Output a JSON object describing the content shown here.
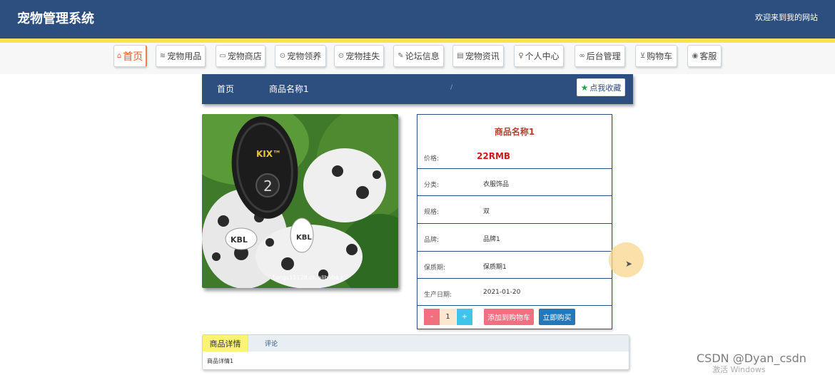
{
  "app": {
    "title": "宠物管理系统",
    "welcome": "欢迎来到我的网站"
  },
  "nav": [
    {
      "icon": "home-icon",
      "glyph": "⌂",
      "label": "首页"
    },
    {
      "icon": "supplies-icon",
      "glyph": "≋",
      "label": "宠物用品"
    },
    {
      "icon": "shop-icon",
      "glyph": "▭",
      "label": "宠物商店"
    },
    {
      "icon": "adopt-icon",
      "glyph": "⊙",
      "label": "宠物领养"
    },
    {
      "icon": "lost-icon",
      "glyph": "⊙",
      "label": "宠物挂失"
    },
    {
      "icon": "forum-icon",
      "glyph": "✎",
      "label": "论坛信息"
    },
    {
      "icon": "news-icon",
      "glyph": "▤",
      "label": "宠物资讯"
    },
    {
      "icon": "user-icon",
      "glyph": "♀",
      "label": "个人中心"
    },
    {
      "icon": "link-icon",
      "glyph": "∞",
      "label": "后台管理"
    },
    {
      "icon": "cart-icon",
      "glyph": "⊻",
      "label": "购物车"
    },
    {
      "icon": "service-icon",
      "glyph": "◉",
      "label": "客服"
    }
  ],
  "breadcrumb": {
    "home": "首页",
    "separator": "/",
    "current": "商品名称1"
  },
  "favorite_label": "点我收藏",
  "product": {
    "name": "商品名称1",
    "price_label": "价格:",
    "price": "22RMB",
    "fields": [
      {
        "label": "分类:",
        "value": "衣服饰品"
      },
      {
        "label": "规格:",
        "value": "双"
      },
      {
        "label": "品牌:",
        "value": "品牌1"
      },
      {
        "label": "保质期:",
        "value": "保质期1"
      },
      {
        "label": "生产日期:",
        "value": "2021-01-20"
      }
    ],
    "image_watermark": "1ongs11128.cn.alibaba.c",
    "image_texts": {
      "sole": "KIX™",
      "number": "2",
      "badge": "KBL"
    }
  },
  "cart": {
    "minus": "-",
    "quantity": "1",
    "plus": "+",
    "add_to_cart": "添加到购物车",
    "buy_now": "立即购买"
  },
  "tabs": {
    "details": "商品详情",
    "comments": "评论",
    "content": "商品详情1"
  },
  "watermarks": {
    "csdn": "CSDN @Dyan_csdn",
    "windows": "激活 Windows"
  },
  "colors": {
    "header": "#2c4f80",
    "accent_yellow": "#f5e64a",
    "price": "#d01818",
    "add_cart": "#f07080",
    "buy_now": "#2278b8"
  }
}
